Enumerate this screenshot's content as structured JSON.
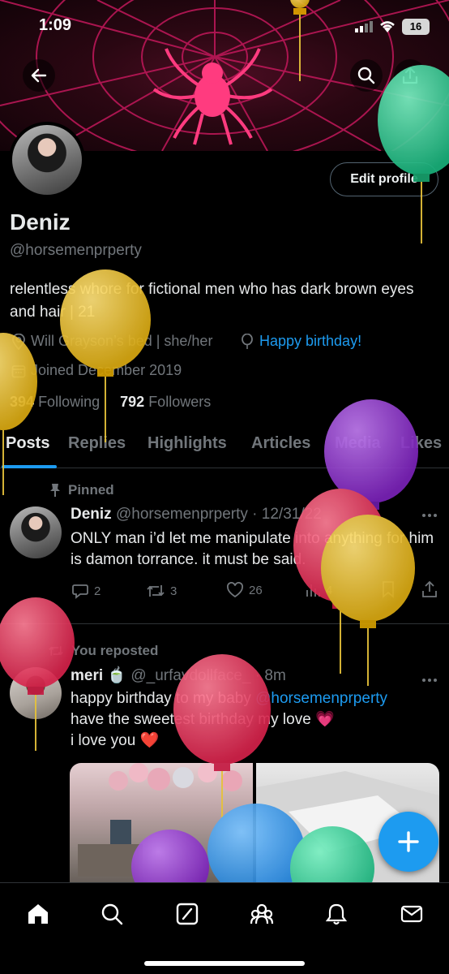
{
  "status_bar": {
    "time": "1:09",
    "battery": "16"
  },
  "profile": {
    "display_name": "Deniz",
    "handle": "@horsemenprperty",
    "bio": "relentless whore for fictional men who has dark brown eyes and hair | 21",
    "location": "Will Grayson’s bed | she/her",
    "birthday": "Happy birthday!",
    "joined": "Joined December 2019",
    "following_count": "394",
    "following_label": "Following",
    "followers_count": "792",
    "followers_label": "Followers",
    "edit_label": "Edit profile"
  },
  "tabs": [
    "Posts",
    "Replies",
    "Highlights",
    "Articles",
    "Media",
    "Likes"
  ],
  "posts": [
    {
      "context": "Pinned",
      "author": "Deniz",
      "handle": "@horsemenprperty",
      "date": "· 12/31/22",
      "text": "ONLY man i’d let me manipulate into anything for him is damon torrance. it must be said.",
      "replies": "2",
      "reposts": "3",
      "likes": "26",
      "views": "4"
    },
    {
      "context": "You reposted",
      "author": "meri 🍵",
      "handle": "@_urfavdollface_",
      "date": "· 8m",
      "text_before": "happy birthday to my baby ",
      "mention": "@horsemenprperty",
      "text_after": "have the sweetest birthday my love 💗",
      "text_line3": "i love you ❤️"
    }
  ],
  "colors": {
    "accent": "#1d9bf0",
    "balloon_green": "#2ecc8f",
    "balloon_yellow": "#e9c12a",
    "balloon_purple": "#8e35c9",
    "balloon_red": "#e33a5c",
    "balloon_blue": "#2f97e8"
  }
}
